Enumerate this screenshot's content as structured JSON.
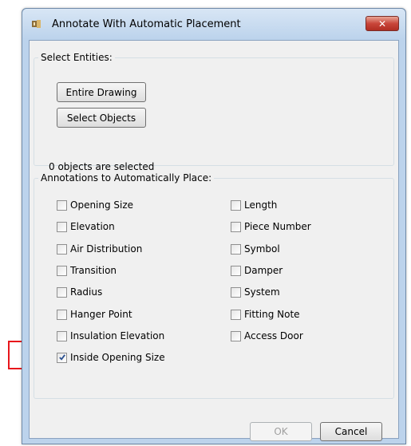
{
  "window": {
    "title": "Annotate With Automatic Placement",
    "close_label": "✕"
  },
  "select_entities": {
    "legend": "Select Entities:",
    "entire_drawing_label": "Entire Drawing",
    "select_objects_label": "Select Objects",
    "status": "0 objects are selected"
  },
  "annotations": {
    "legend": "Annotations to Automatically Place:",
    "left": [
      {
        "label": "Opening Size",
        "checked": false
      },
      {
        "label": "Elevation",
        "checked": false
      },
      {
        "label": "Air Distribution",
        "checked": false
      },
      {
        "label": "Transition",
        "checked": false
      },
      {
        "label": "Radius",
        "checked": false
      },
      {
        "label": "Hanger Point",
        "checked": false
      },
      {
        "label": "Insulation Elevation",
        "checked": false
      },
      {
        "label": "Inside Opening Size",
        "checked": true
      }
    ],
    "right": [
      {
        "label": "Length",
        "checked": false
      },
      {
        "label": "Piece Number",
        "checked": false
      },
      {
        "label": "Symbol",
        "checked": false
      },
      {
        "label": "Damper",
        "checked": false
      },
      {
        "label": "System",
        "checked": false
      },
      {
        "label": "Fitting Note",
        "checked": false
      },
      {
        "label": "Access Door",
        "checked": false
      }
    ]
  },
  "footer": {
    "ok_label": "OK",
    "cancel_label": "Cancel"
  },
  "colors": {
    "highlight": "#e8161b",
    "checkmark": "#2a4f8f"
  }
}
